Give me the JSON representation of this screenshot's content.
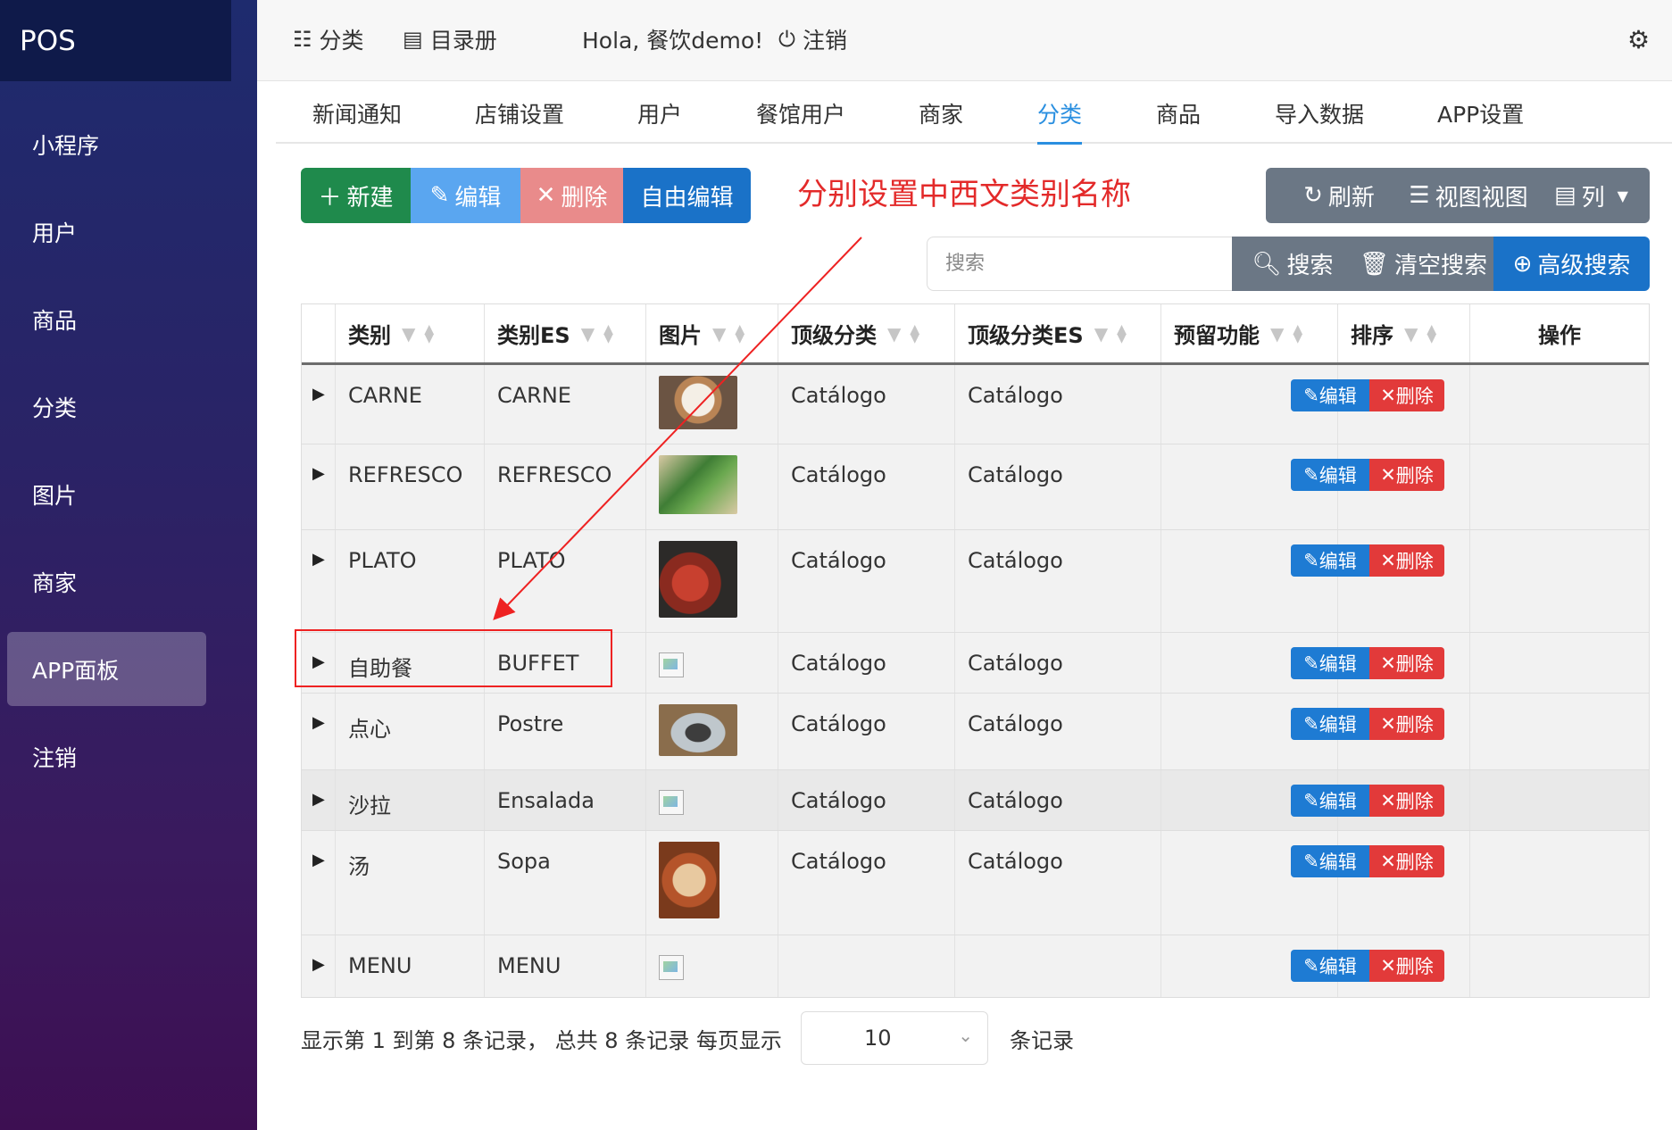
{
  "sidebar": {
    "brand": "POS",
    "items": [
      {
        "label": "小程序"
      },
      {
        "label": "用户"
      },
      {
        "label": "商品"
      },
      {
        "label": "分类"
      },
      {
        "label": "图片"
      },
      {
        "label": "商家"
      },
      {
        "label": "APP面板",
        "active": true
      },
      {
        "label": "注销"
      }
    ]
  },
  "topbar": {
    "category_link": "分类",
    "catalog_link": "目录册",
    "greeting": "Hola, 餐饮demo!",
    "logout": "注销",
    "settings_icon": "gear-icon"
  },
  "tabs": [
    {
      "label": "新闻通知"
    },
    {
      "label": "店铺设置"
    },
    {
      "label": "用户"
    },
    {
      "label": "餐馆用户"
    },
    {
      "label": "商家"
    },
    {
      "label": "分类",
      "active": true
    },
    {
      "label": "商品"
    },
    {
      "label": "导入数据"
    },
    {
      "label": "APP设置"
    }
  ],
  "toolbar": {
    "new": "新建",
    "edit": "编辑",
    "delete": "删除",
    "free_edit": "自由编辑",
    "refresh": "刷新",
    "view": "视图视图",
    "columns": "列"
  },
  "annotation": "分别设置中西文类别名称",
  "search": {
    "placeholder": "搜索",
    "search_btn": "搜索",
    "clear_btn": "清空搜索",
    "advanced_btn": "高级搜索"
  },
  "table": {
    "headers": [
      "类别",
      "类别ES",
      "图片",
      "顶级分类",
      "顶级分类ES",
      "预留功能",
      "排序",
      "操作"
    ],
    "rows": [
      {
        "cat": "CARNE",
        "cat_es": "CARNE",
        "image": "coffee",
        "top": "Catálogo",
        "top_es": "Catálogo"
      },
      {
        "cat": "REFRESCO",
        "cat_es": "REFRESCO",
        "image": "herbs",
        "top": "Catálogo",
        "top_es": "Catálogo"
      },
      {
        "cat": "PLATO",
        "cat_es": "PLATO",
        "image": "lobster",
        "top": "Catálogo",
        "top_es": "Catálogo"
      },
      {
        "cat": "自助餐",
        "cat_es": "BUFFET",
        "image": "broken",
        "top": "Catálogo",
        "top_es": "Catálogo"
      },
      {
        "cat": "点心",
        "cat_es": "Postre",
        "image": "soup",
        "top": "Catálogo",
        "top_es": "Catálogo"
      },
      {
        "cat": "沙拉",
        "cat_es": "Ensalada",
        "image": "broken",
        "top": "Catálogo",
        "top_es": "Catálogo"
      },
      {
        "cat": "汤",
        "cat_es": "Sopa",
        "image": "hotpot",
        "top": "Catálogo",
        "top_es": "Catálogo"
      },
      {
        "cat": "MENU",
        "cat_es": "MENU",
        "image": "broken",
        "top": "",
        "top_es": ""
      }
    ],
    "row_edit": "编辑",
    "row_delete": "删除"
  },
  "footer": {
    "summary": "显示第 1 到第 8 条记录， 总共 8 条记录 每页显示",
    "page_size": "10",
    "suffix": "条记录"
  },
  "colors": {
    "new": "#1f8a4c",
    "edit": "#5aa6f0",
    "delete": "#e98b8b",
    "free_edit": "#1a72c8",
    "right_group": "#6b7785",
    "advanced": "#1a72c8",
    "accent": "#2a8fe0"
  }
}
